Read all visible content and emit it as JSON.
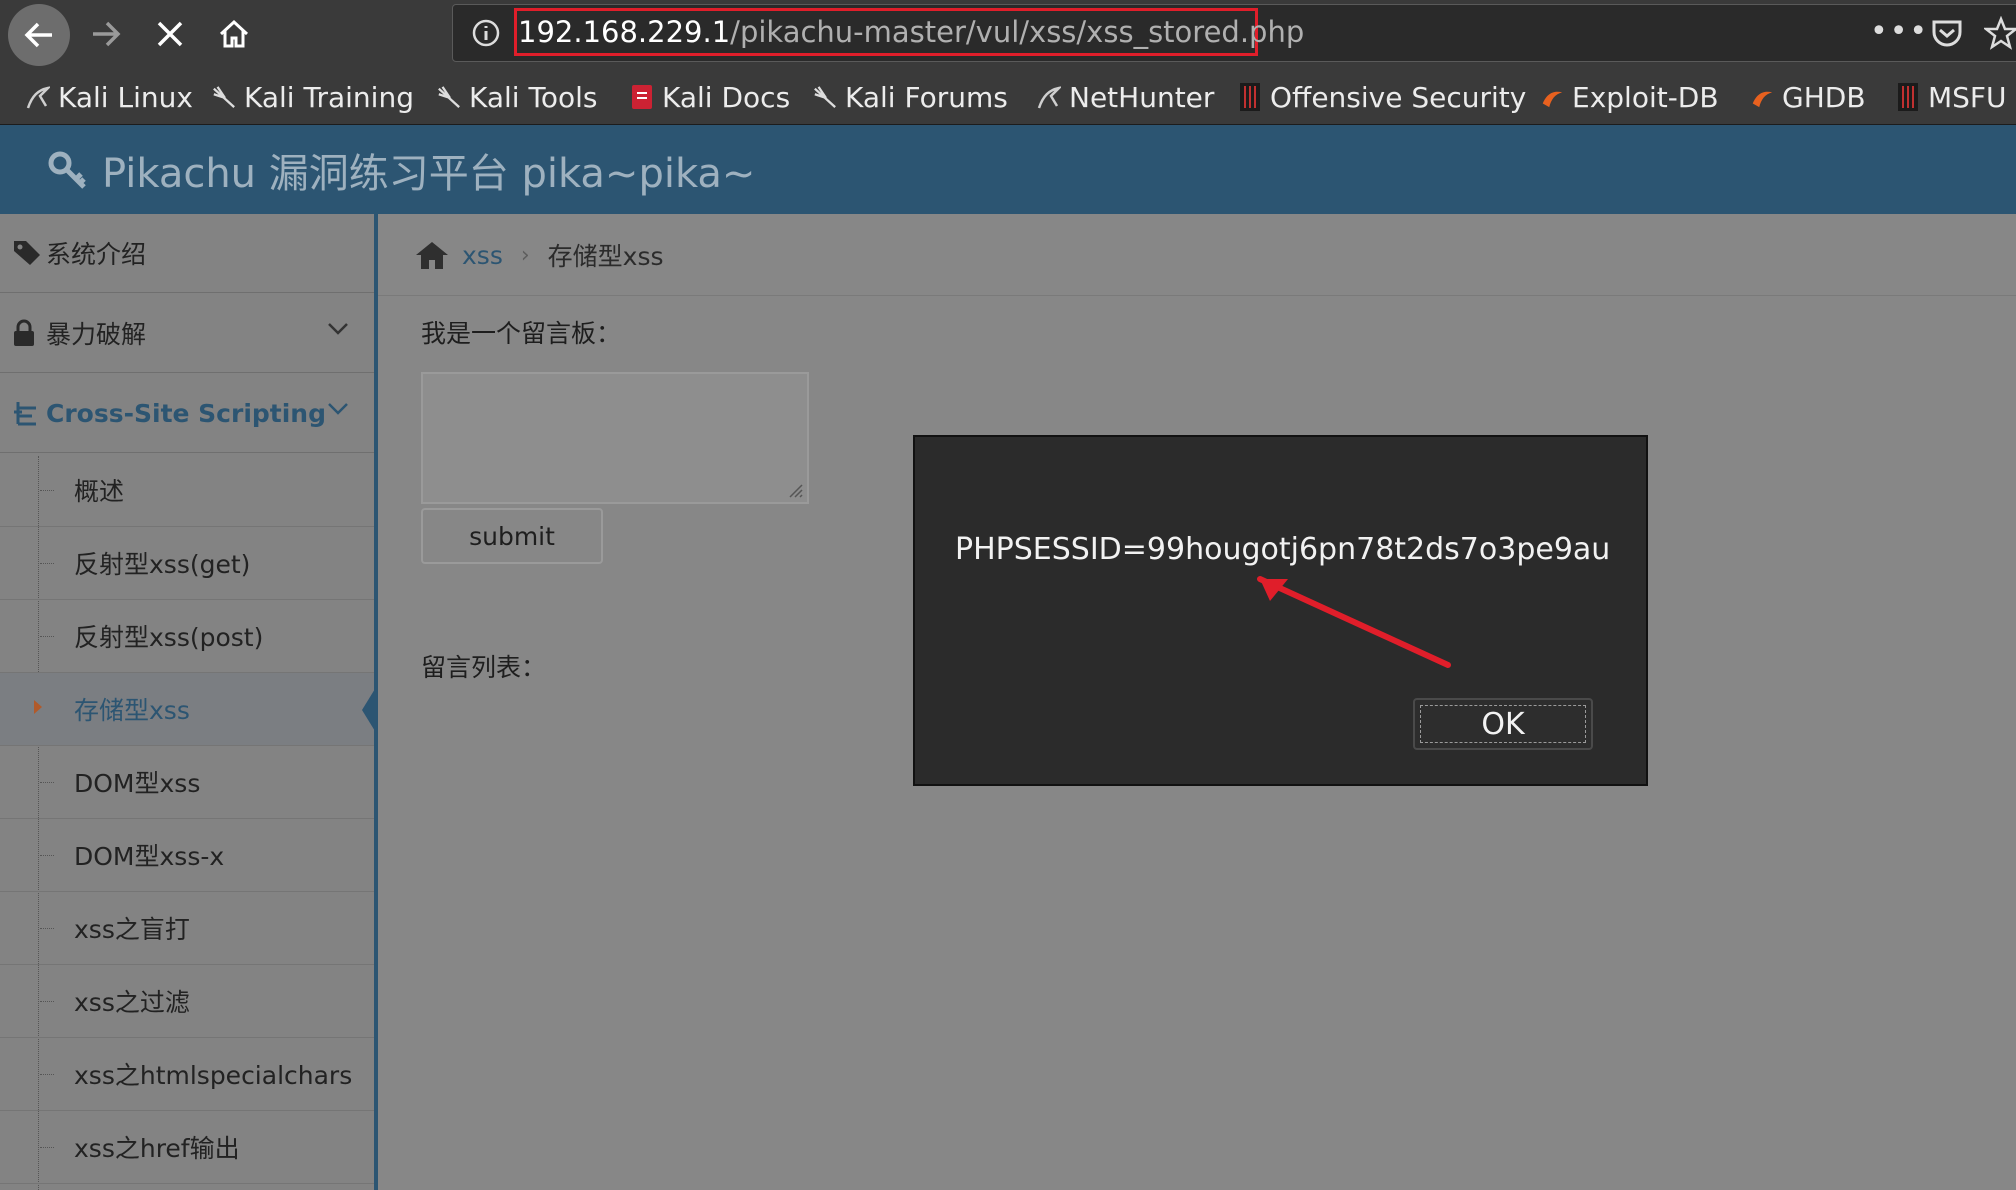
{
  "browser": {
    "url_host": "192.168.229.1",
    "url_path": "/pikachu-master/vul/xss/xss_stored.php",
    "bookmarks": [
      {
        "label": "Kali Linux",
        "icon": "kali-dragon-icon"
      },
      {
        "label": "Kali Training",
        "icon": "kali-dragon-icon"
      },
      {
        "label": "Kali Tools",
        "icon": "kali-dragon-icon"
      },
      {
        "label": "Kali Docs",
        "icon": "kali-docs-icon"
      },
      {
        "label": "Kali Forums",
        "icon": "kali-dragon-icon"
      },
      {
        "label": "NetHunter",
        "icon": "kali-dragon-icon"
      },
      {
        "label": "Offensive Security",
        "icon": "offsec-icon"
      },
      {
        "label": "Exploit-DB",
        "icon": "exploitdb-icon"
      },
      {
        "label": "GHDB",
        "icon": "exploitdb-icon"
      },
      {
        "label": "MSFU",
        "icon": "offsec-icon"
      }
    ],
    "highlight_color": "#e01e2a"
  },
  "app": {
    "title": "Pikachu 漏洞练习平台 pika~pika~",
    "header_color": "#2c5572"
  },
  "sidebar": {
    "sections": [
      {
        "label": "系统介绍",
        "icon": "tags-icon"
      },
      {
        "label": "暴力破解",
        "icon": "lock-icon"
      },
      {
        "label": "Cross-Site Scripting",
        "icon": "sitemap-icon"
      }
    ],
    "sub_items": [
      {
        "label": "概述"
      },
      {
        "label": "反射型xss(get)"
      },
      {
        "label": "反射型xss(post)"
      },
      {
        "label": "存储型xss"
      },
      {
        "label": "DOM型xss"
      },
      {
        "label": "DOM型xss-x"
      },
      {
        "label": "xss之盲打"
      },
      {
        "label": "xss之过滤"
      },
      {
        "label": "xss之htmlspecialchars"
      },
      {
        "label": "xss之href输出"
      }
    ],
    "active_sub_item": "存储型xss"
  },
  "main": {
    "breadcrumb": {
      "link": "xss",
      "current": "存储型xss"
    },
    "board_label": "我是一个留言板：",
    "textarea_value": "",
    "submit_label": "submit",
    "list_label": "留言列表："
  },
  "dialog": {
    "message": "PHPSESSID=99hougotj6pn78t2ds7o3pe9au",
    "ok_label": "OK"
  }
}
